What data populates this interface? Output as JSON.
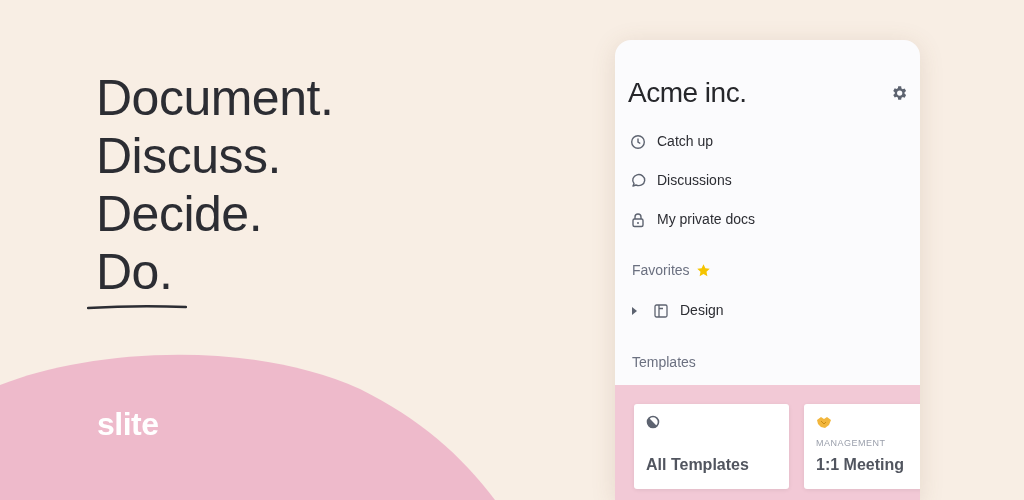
{
  "headline": [
    "Document.",
    "Discuss.",
    "Decide.",
    "Do."
  ],
  "logo": {
    "text": "slite"
  },
  "sidebar": {
    "workspace": "Acme inc.",
    "items": [
      {
        "label": "Catch up"
      },
      {
        "label": "Discussions"
      },
      {
        "label": "My private docs"
      }
    ],
    "favorites": {
      "title": "Favorites",
      "items": [
        {
          "label": "Design",
          "expanded": false
        }
      ]
    },
    "templates": {
      "title": "Templates",
      "cards": [
        {
          "label": "All Templates"
        },
        {
          "category": "MANAGEMENT",
          "label": "1:1 Meeting"
        }
      ]
    }
  }
}
